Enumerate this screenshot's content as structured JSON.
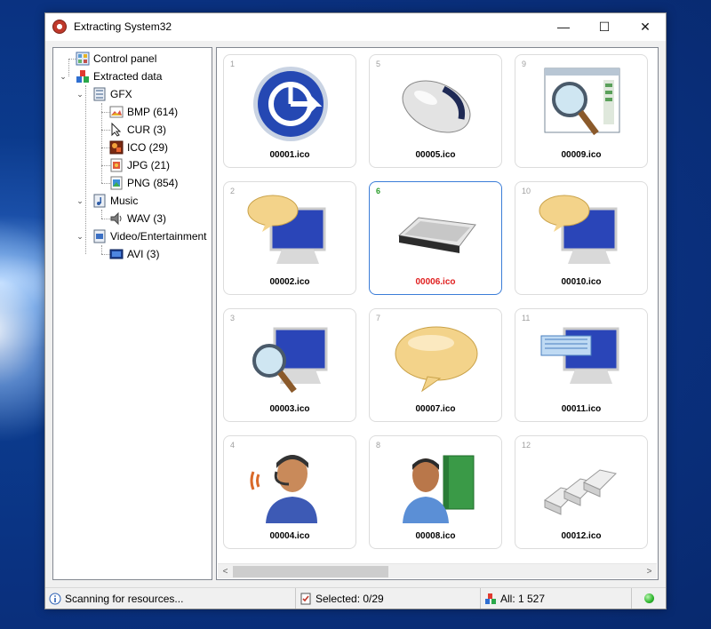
{
  "window": {
    "title": "Extracting System32",
    "controls": {
      "minimize": "—",
      "maximize": "☐",
      "close": "✕"
    }
  },
  "tree": {
    "nodes": [
      {
        "label": "Control panel",
        "icon": "control-panel-icon",
        "expander": ""
      },
      {
        "label": "Extracted data",
        "icon": "extracted-data-icon",
        "expander": "⌄"
      },
      {
        "label": "GFX",
        "icon": "folder-gfx-icon",
        "expander": "⌄"
      },
      {
        "label": "BMP (614)",
        "icon": "bmp-file-icon",
        "expander": ""
      },
      {
        "label": "CUR (3)",
        "icon": "cursor-file-icon",
        "expander": ""
      },
      {
        "label": "ICO (29)",
        "icon": "ico-file-icon",
        "expander": ""
      },
      {
        "label": "JPG (21)",
        "icon": "jpg-file-icon",
        "expander": ""
      },
      {
        "label": "PNG (854)",
        "icon": "png-file-icon",
        "expander": ""
      },
      {
        "label": "Music",
        "icon": "music-folder-icon",
        "expander": "⌄"
      },
      {
        "label": "WAV (3)",
        "icon": "wav-file-icon",
        "expander": ""
      },
      {
        "label": "Video/Entertainment",
        "icon": "video-folder-icon",
        "expander": "⌄"
      },
      {
        "label": "AVI (3)",
        "icon": "avi-file-icon",
        "expander": ""
      }
    ]
  },
  "tiles": [
    {
      "num": "1",
      "label": "00001.ico",
      "icon": "clock-circle-icon",
      "selected": false
    },
    {
      "num": "5",
      "label": "00005.ico",
      "icon": "mouse-icon",
      "selected": false
    },
    {
      "num": "9",
      "label": "00009.ico",
      "icon": "magnifier-window-icon",
      "selected": false
    },
    {
      "num": "2",
      "label": "00002.ico",
      "icon": "monitor-speech-icon",
      "selected": false
    },
    {
      "num": "6",
      "label": "00006.ico",
      "icon": "keyboard-icon",
      "selected": true
    },
    {
      "num": "10",
      "label": "00010.ico",
      "icon": "monitor-speech-icon",
      "selected": false
    },
    {
      "num": "3",
      "label": "00003.ico",
      "icon": "monitor-magnifier-icon",
      "selected": false
    },
    {
      "num": "7",
      "label": "00007.ico",
      "icon": "speech-bubble-icon",
      "selected": false
    },
    {
      "num": "11",
      "label": "00011.ico",
      "icon": "monitor-keyboard-icon",
      "selected": false
    },
    {
      "num": "4",
      "label": "00004.ico",
      "icon": "headset-person-icon",
      "selected": false
    },
    {
      "num": "8",
      "label": "00008.ico",
      "icon": "person-book-icon",
      "selected": false
    },
    {
      "num": "12",
      "label": "00012.ico",
      "icon": "keys-icon",
      "selected": false
    }
  ],
  "scrollbar": {
    "left": "<",
    "right": ">"
  },
  "status": {
    "scanning": "Scanning for resources...",
    "selected": "Selected: 0/29",
    "all": "All: 1 527"
  },
  "colors": {
    "selected_border": "#3b7dd8",
    "selected_label": "#e02020",
    "selected_number": "#2a9d2a",
    "status_led": "#2db52d"
  }
}
